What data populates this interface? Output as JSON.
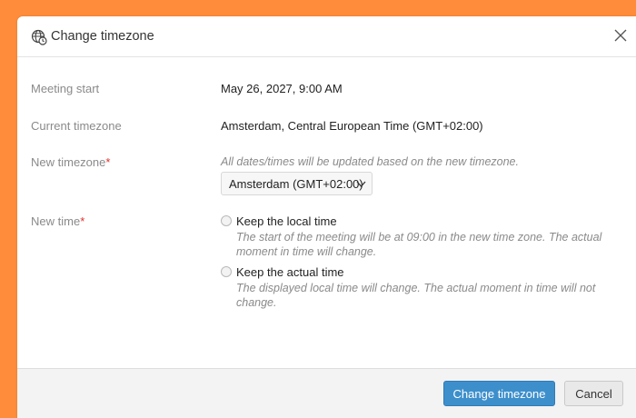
{
  "dialog": {
    "title": "Change timezone",
    "title_icon": "globe-clock-icon",
    "close_icon": "close-icon"
  },
  "fields": {
    "meeting_start": {
      "label": "Meeting start",
      "value": "May 26, 2027, 9:00 AM"
    },
    "current_timezone": {
      "label": "Current timezone",
      "value": "Amsterdam, Central European Time (GMT+02:00)"
    },
    "new_timezone": {
      "label": "New timezone",
      "required_mark": "*",
      "hint": "All dates/times will be updated based on the new timezone.",
      "selected": "Amsterdam (GMT+02:00)"
    },
    "new_time": {
      "label": "New time",
      "required_mark": "*",
      "options": [
        {
          "label": "Keep the local time",
          "description": "The start of the meeting will be at 09:00 in the new time zone. The actual moment in time will change.",
          "selected": false
        },
        {
          "label": "Keep the actual time",
          "description": "The displayed local time will change. The actual moment in time will not change.",
          "selected": false
        }
      ]
    }
  },
  "footer": {
    "primary_label": "Change timezone",
    "cancel_label": "Cancel"
  },
  "colors": {
    "background": "#ff8c3a",
    "primary": "#3d8fcc",
    "required": "#e03030"
  }
}
